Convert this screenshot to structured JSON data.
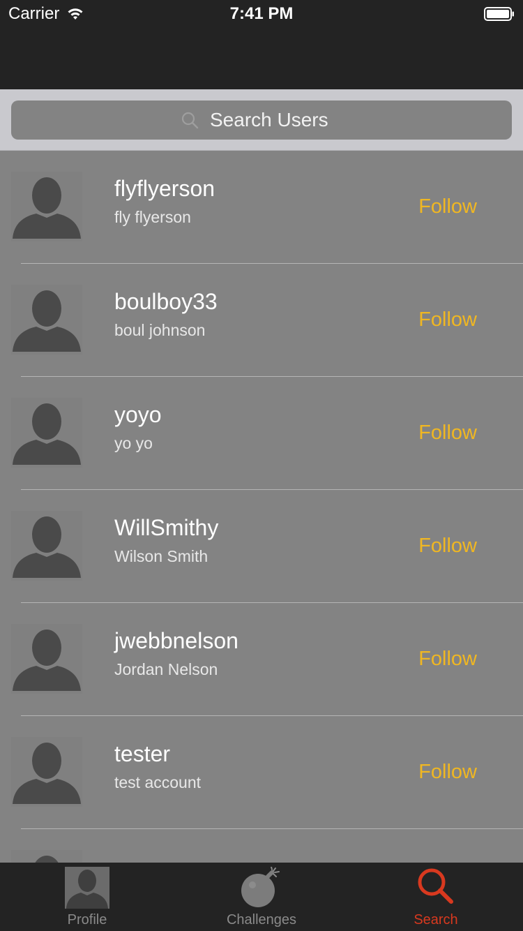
{
  "status_bar": {
    "carrier": "Carrier",
    "time": "7:41 PM"
  },
  "search": {
    "placeholder": "Search Users",
    "value": ""
  },
  "users": [
    {
      "username": "flyflyerson",
      "full_name": "fly flyerson",
      "action": "Follow"
    },
    {
      "username": "boulboy33",
      "full_name": "boul johnson",
      "action": "Follow"
    },
    {
      "username": "yoyo",
      "full_name": "yo yo",
      "action": "Follow"
    },
    {
      "username": "WillSmithy",
      "full_name": "Wilson Smith",
      "action": "Follow"
    },
    {
      "username": "jwebbnelson",
      "full_name": "Jordan Nelson",
      "action": "Follow"
    },
    {
      "username": "tester",
      "full_name": "test account",
      "action": "Follow"
    }
  ],
  "tabs": [
    {
      "label": "Profile",
      "icon": "person-icon",
      "active": false
    },
    {
      "label": "Challenges",
      "icon": "bomb-icon",
      "active": false
    },
    {
      "label": "Search",
      "icon": "search-icon",
      "active": true
    }
  ],
  "colors": {
    "accent_follow": "#f0b722",
    "active_tab": "#d8391f",
    "bar_background": "#232323",
    "list_background": "#838383"
  }
}
